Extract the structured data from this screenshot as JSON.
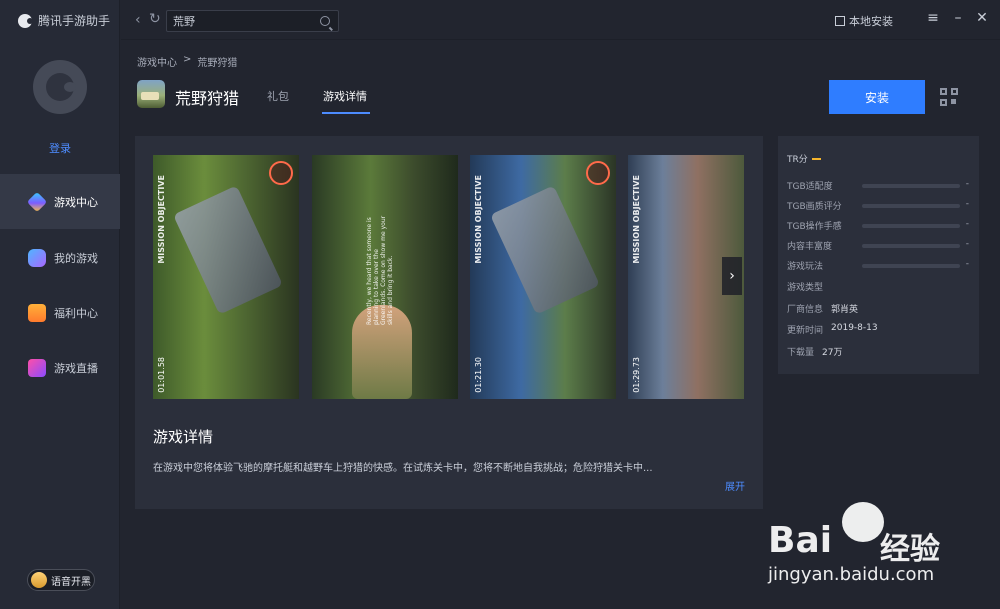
{
  "app": {
    "title": "腾讯手游助手"
  },
  "sidebar": {
    "login_label": "登录",
    "items": [
      {
        "label": "游戏中心",
        "icon": "game-center-icon",
        "active": true
      },
      {
        "label": "我的游戏",
        "icon": "gamepad-icon",
        "active": false
      },
      {
        "label": "福利中心",
        "icon": "gift-icon",
        "active": false
      },
      {
        "label": "游戏直播",
        "icon": "live-video-icon",
        "active": false
      }
    ],
    "voice_button": "语音开黑"
  },
  "topbar": {
    "search_value": "荒野",
    "local_install_label": "本地安装"
  },
  "breadcrumb": {
    "home": "游戏中心",
    "separator": ">",
    "current": "荒野狩猎"
  },
  "game": {
    "title": "荒野狩猎",
    "tabs": [
      {
        "label": "礼包",
        "active": false
      },
      {
        "label": "游戏详情",
        "active": true
      }
    ],
    "install_label": "安装"
  },
  "screenshots": [
    {
      "vertical_label": "MISSION OBJECTIVE",
      "time": "01:01.58"
    },
    {
      "vertical_label": "Recently, we heard that someone is planning to take over the Greenlands. Come on show me your skills and bring it back.",
      "time": ""
    },
    {
      "vertical_label": "MISSION OBJECTIVE",
      "time": "01:21.30"
    },
    {
      "vertical_label": "MISSION OBJECTIVE",
      "time": "01:29.73"
    }
  ],
  "details": {
    "section_title": "游戏详情",
    "description": "在游戏中您将体验飞驰的摩托艇和越野车上狩猎的快感。在试炼关卡中，您将不断地自我挑战；危险狩猎关卡中...",
    "expand_label": "展开"
  },
  "info": {
    "tr_score_label": "TR分",
    "ratings": [
      {
        "label": "TGB适配度",
        "value": "-"
      },
      {
        "label": "TGB画质评分",
        "value": "-"
      },
      {
        "label": "TGB操作手感",
        "value": "-"
      },
      {
        "label": "内容丰富度",
        "value": "-"
      },
      {
        "label": "游戏玩法",
        "value": "-"
      }
    ],
    "game_type_label": "游戏类型",
    "vendor_label": "厂商信息",
    "vendor_value": "郭肖英",
    "update_label": "更新时间",
    "update_value": "2019-8-13",
    "downloads_label": "下载量",
    "downloads_value": "27万"
  },
  "watermark": {
    "brand_latin": "Bai",
    "brand_cn": "经验",
    "url": "jingyan.baidu.com"
  },
  "colors": {
    "accent": "#2f7dff",
    "link": "#4d8cff",
    "bg": "#22252f",
    "panel": "#2b2f3b"
  }
}
